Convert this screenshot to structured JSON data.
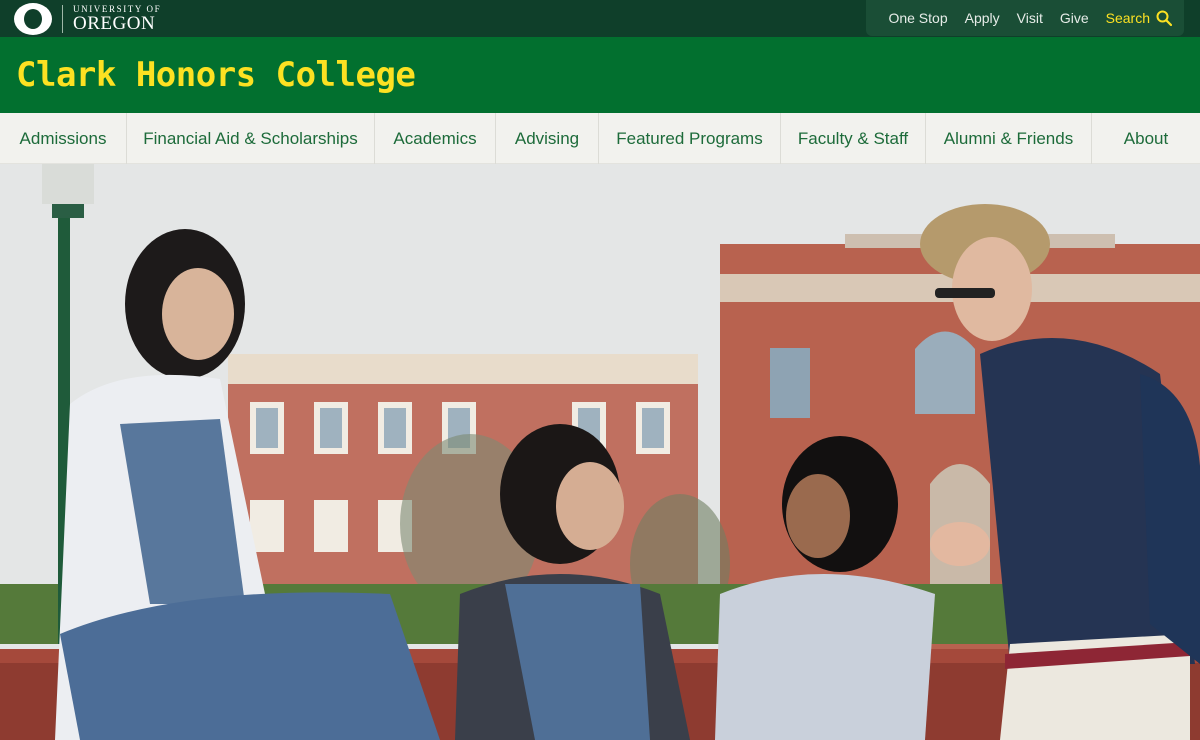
{
  "brand": {
    "small": "UNIVERSITY OF",
    "big": "OREGON",
    "logo_icon": "o-logo-icon"
  },
  "utility": {
    "links": [
      "One Stop",
      "Apply",
      "Visit",
      "Give"
    ],
    "search_label": "Search",
    "search_icon": "search-icon",
    "accent": "#fce122"
  },
  "site": {
    "title": "Clark Honors College",
    "green": "#02702f",
    "yellow": "#fce122"
  },
  "nav": {
    "items": [
      "Admissions",
      "Financial Aid & Scholarships",
      "Academics",
      "Advising",
      "Featured Programs",
      "Faculty & Staff",
      "Alumni & Friends",
      "About"
    ]
  }
}
